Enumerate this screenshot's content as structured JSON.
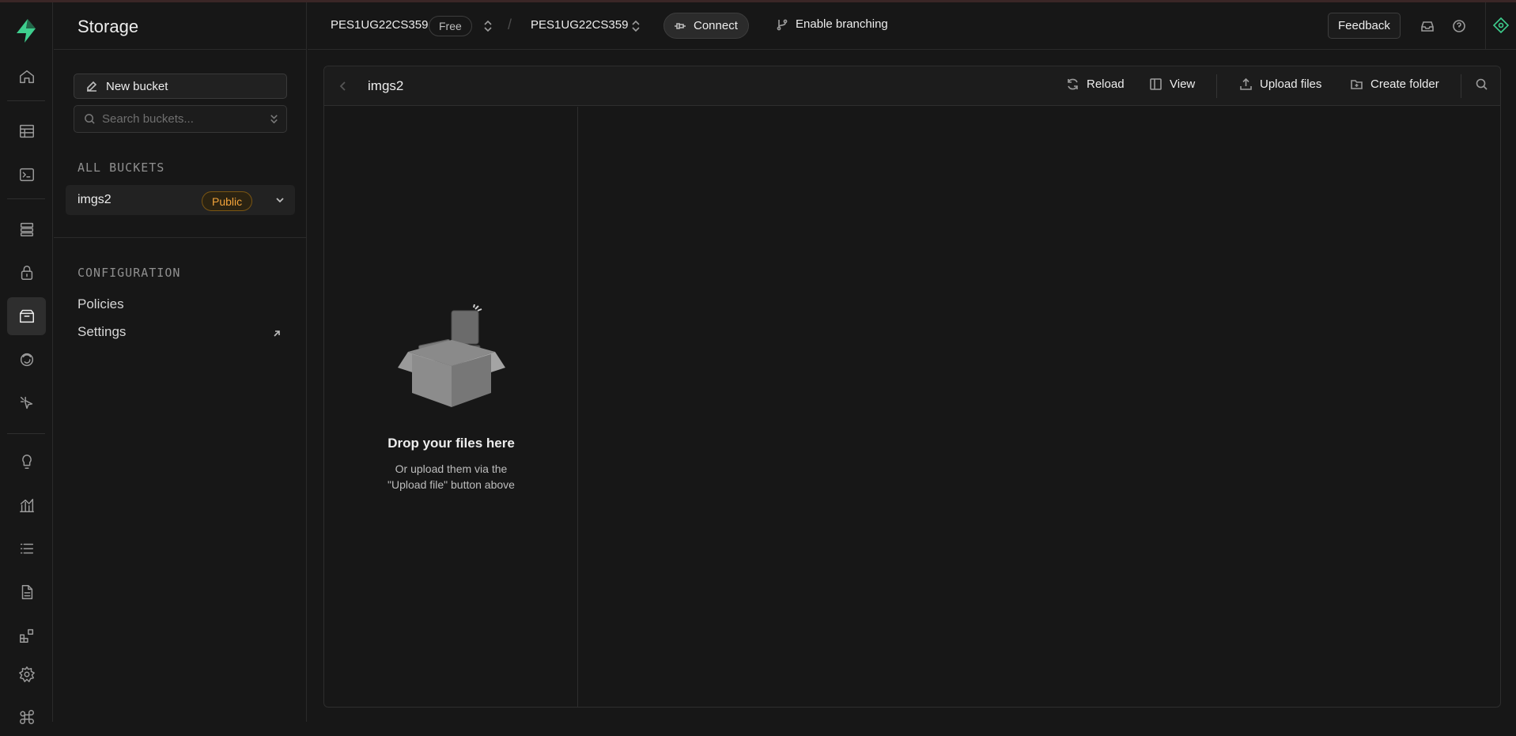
{
  "app": {
    "section_title": "Storage",
    "project": {
      "org": "PES1UG22CS359",
      "plan_badge": "Free",
      "name": "PES1UG22CS359",
      "separator": "/"
    },
    "connect_label": "Connect",
    "branching_label": "Enable branching",
    "feedback_label": "Feedback"
  },
  "rail": {
    "items": [
      {
        "icon": "home-icon",
        "active": false
      },
      {
        "icon": "table-editor-icon",
        "active": false
      },
      {
        "icon": "sql-editor-icon",
        "active": false
      },
      {
        "icon": "database-icon",
        "active": false
      },
      {
        "icon": "auth-lock-icon",
        "active": false
      },
      {
        "icon": "storage-icon",
        "active": true
      },
      {
        "icon": "realtime-icon",
        "active": false
      },
      {
        "icon": "edge-functions-icon",
        "active": false
      },
      {
        "icon": "advisors-bulb-icon",
        "active": false
      },
      {
        "icon": "reports-icon",
        "active": false
      },
      {
        "icon": "logs-icon",
        "active": false
      },
      {
        "icon": "api-docs-icon",
        "active": false
      },
      {
        "icon": "integrations-icon",
        "active": false
      },
      {
        "icon": "settings-gear-icon",
        "active": false
      },
      {
        "icon": "command-icon",
        "active": false
      }
    ]
  },
  "sidebar": {
    "new_bucket_label": "New bucket",
    "search_placeholder": "Search buckets...",
    "all_buckets_heading": "ALL BUCKETS",
    "buckets": [
      {
        "name": "imgs2",
        "badge": "Public"
      }
    ],
    "configuration_heading": "CONFIGURATION",
    "config_items": [
      {
        "label": "Policies"
      },
      {
        "label": "Settings"
      }
    ]
  },
  "explorer": {
    "breadcrumb": "imgs2",
    "toolbar": {
      "reload": "Reload",
      "view": "View",
      "upload": "Upload files",
      "create_folder": "Create folder"
    },
    "empty_state": {
      "title": "Drop your files here",
      "subtitle": "Or upload them via the \"Upload file\" button above"
    }
  },
  "colors": {
    "background": "#171717",
    "brand": "#3ecf8e",
    "public_badge": "#f2a33a"
  }
}
